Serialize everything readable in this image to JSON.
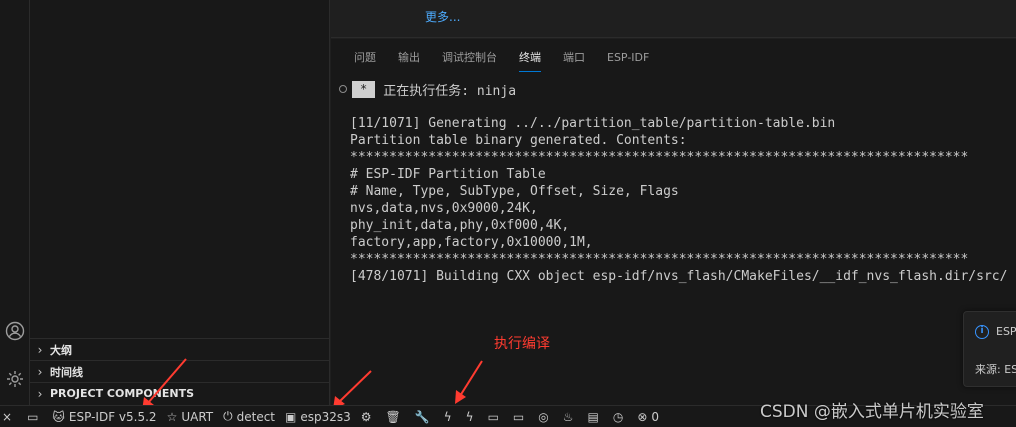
{
  "editor": {
    "more_link": "更多..."
  },
  "panel": {
    "tabs": [
      "问题",
      "输出",
      "调试控制台",
      "终端",
      "端口",
      "ESP-IDF"
    ],
    "active_tab": "终端"
  },
  "terminal": {
    "task_badge": "*",
    "task_text": "正在执行任务: ninja",
    "lines": [
      "[11/1071] Generating ../../partition_table/partition-table.bin",
      "Partition table binary generated. Contents:",
      "*******************************************************************************",
      "# ESP-IDF Partition Table",
      "# Name, Type, SubType, Offset, Size, Flags",
      "nvs,data,nvs,0x9000,24K,",
      "phy_init,data,phy,0xf000,4K,",
      "factory,app,factory,0x10000,1M,",
      "*******************************************************************************",
      "[478/1071] Building CXX object esp-idf/nvs_flash/CMakeFiles/__idf_nvs_flash.dir/src/"
    ]
  },
  "sidebar": {
    "sections": [
      {
        "label": "大纲"
      },
      {
        "label": "时间线"
      },
      {
        "label": "PROJECT COMPONENTS"
      }
    ]
  },
  "notification": {
    "title": "ESP",
    "source": "来源: ES"
  },
  "annotation": {
    "text": "执行编译",
    "color": "#ff3b30"
  },
  "status_bar": {
    "idf_version": "ESP-IDF v5.5.2",
    "uart": "UART",
    "detect": "detect",
    "target": "esp32s3",
    "errors": "0",
    "build": "生成"
  },
  "watermark": "CSDN @嵌入式单片机实验室",
  "colors": {
    "accent": "#0078d4",
    "link": "#4daafc",
    "annotation": "#ff3b30"
  }
}
